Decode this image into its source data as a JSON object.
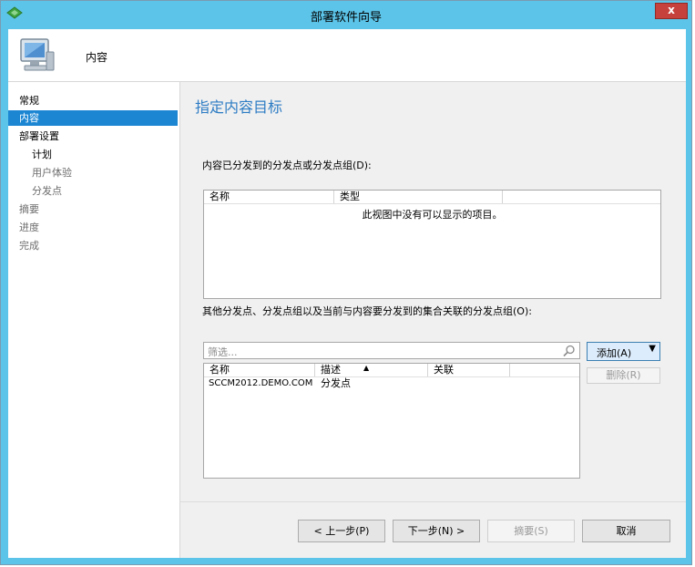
{
  "window": {
    "title": "部署软件向导",
    "close_label": "x"
  },
  "header": {
    "label": "内容"
  },
  "nav": {
    "items": [
      {
        "label": "常规"
      },
      {
        "label": "内容"
      },
      {
        "label": "部署设置"
      },
      {
        "label": "计划"
      },
      {
        "label": "用户体验"
      },
      {
        "label": "分发点"
      },
      {
        "label": "摘要"
      },
      {
        "label": "进度"
      },
      {
        "label": "完成"
      }
    ]
  },
  "main": {
    "title": "指定内容目标",
    "list1": {
      "label": "内容已分发到的分发点或分发点组(D):",
      "columns": [
        "名称",
        "类型"
      ],
      "empty_text": "此视图中没有可以显示的项目。"
    },
    "list2": {
      "label": "其他分发点、分发点组以及当前与内容要分发到的集合关联的分发点组(O):",
      "filter_placeholder": "筛选...",
      "columns": [
        "名称",
        "描述",
        "关联"
      ],
      "rows": [
        {
          "name": "SCCM2012.DEMO.COM",
          "description": "分发点",
          "association": ""
        }
      ]
    },
    "add_button": "添加(A)",
    "remove_button": "删除(R)"
  },
  "footer": {
    "prev_button": "< 上一步(P)",
    "next_button": "下一步(N) >",
    "summary_button": "摘要(S)",
    "cancel_button": "取消"
  }
}
